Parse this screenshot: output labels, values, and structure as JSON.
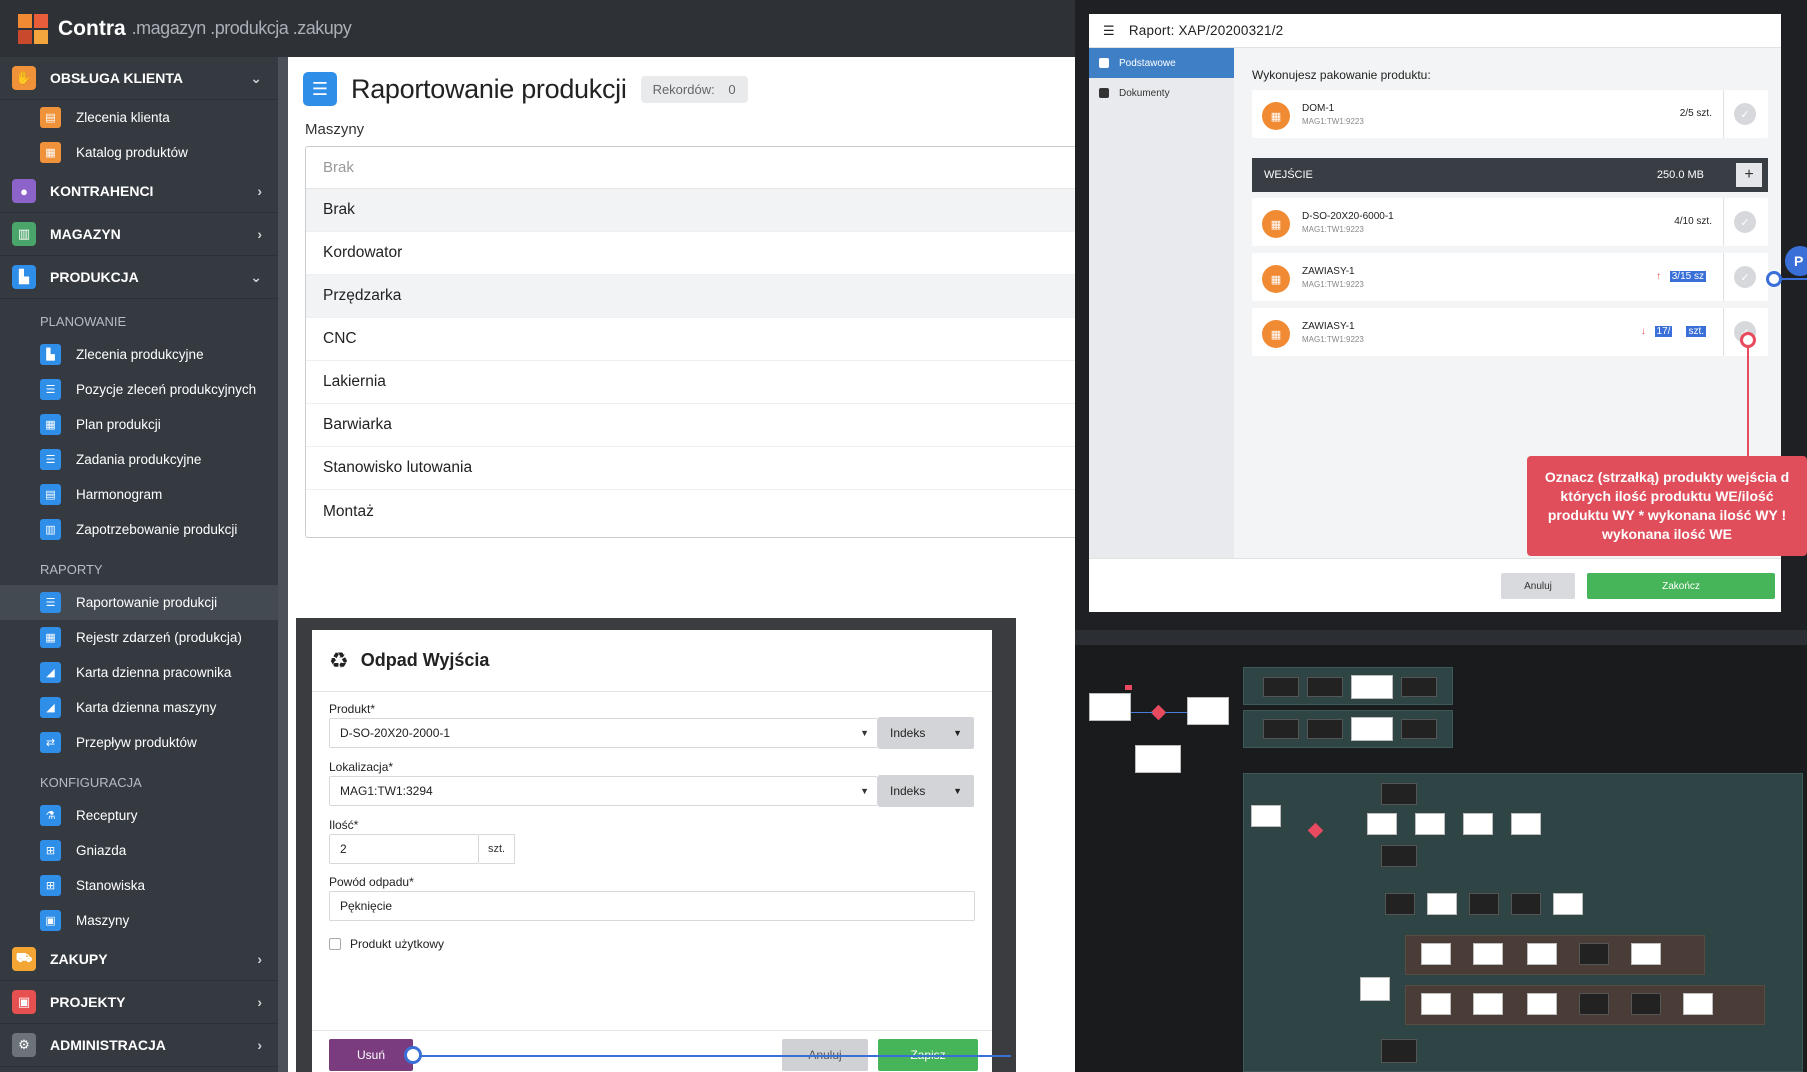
{
  "app": {
    "brand": "Contra",
    "subtitle": ".magazyn .produkcja .zakupy"
  },
  "sidebar": {
    "groups": [
      {
        "label": "OBSŁUGA KLIENTA",
        "chevron": "⌄",
        "icon": "handshake-icon",
        "color": "#f0923a"
      },
      {
        "label": "KONTRAHENCI",
        "chevron": "›",
        "icon": "users-icon",
        "color": "#8b63c9"
      },
      {
        "label": "MAGAZYN",
        "chevron": "›",
        "icon": "warehouse-icon",
        "color": "#4aa56a"
      },
      {
        "label": "PRODUKCJA",
        "chevron": "⌄",
        "icon": "factory-icon",
        "color": "#2f8fe8"
      },
      {
        "label": "ZAKUPY",
        "chevron": "›",
        "icon": "cart-icon",
        "color": "#f3a633"
      },
      {
        "label": "PROJEKTY",
        "chevron": "›",
        "icon": "briefcase-icon",
        "color": "#e65050"
      },
      {
        "label": "ADMINISTRACJA",
        "chevron": "›",
        "icon": "gear-icon",
        "color": "#6d737b"
      }
    ],
    "client_items": [
      "Zlecenia klienta",
      "Katalog produktów"
    ],
    "sections": {
      "planning": "PLANOWANIE",
      "reports": "RAPORTY",
      "config": "KONFIGURACJA"
    },
    "planning_items": [
      "Zlecenia produkcyjne",
      "Pozycje zleceń produkcyjnych",
      "Plan produkcji",
      "Zadania produkcyjne",
      "Harmonogram",
      "Zapotrzebowanie produkcji"
    ],
    "report_items": [
      "Raportowanie produkcji",
      "Rejestr zdarzeń (produkcja)",
      "Karta dzienna pracownika",
      "Karta dzienna maszyny",
      "Przepływ produktów"
    ],
    "config_items": [
      "Receptury",
      "Gniazda",
      "Stanowiska",
      "Maszyny"
    ]
  },
  "main": {
    "title": "Raportowanie produkcji",
    "records_label": "Rekordów:",
    "records_count": "0",
    "machines_label": "Maszyny",
    "placeholder": "Brak",
    "options": [
      "Brak",
      "Kordowator",
      "Przędzarka",
      "CNC",
      "Lakiernia",
      "Barwiarka",
      "Stanowisko lutowania",
      "Montaż"
    ]
  },
  "dialog": {
    "title": "Odpad Wyjścia",
    "product_label": "Produkt*",
    "product_value": "D-SO-20X20-2000-1",
    "location_label": "Lokalizacja*",
    "location_value": "MAG1:TW1:3294",
    "index_label": "Indeks",
    "qty_label": "Ilość*",
    "qty_value": "2",
    "qty_unit": "szt.",
    "reason_label": "Powód odpadu*",
    "reason_value": "Pęknięcie",
    "usable_label": "Produkt użytkowy",
    "delete_btn": "Usuń",
    "cancel_btn": "Anuluj",
    "save_btn": "Zapisz"
  },
  "report": {
    "title": "Raport: XAP/20200321/2",
    "tabs": [
      "Podstawowe",
      "Dokumenty"
    ],
    "pack_label": "Wykonujesz pakowanie produktu:",
    "output_product": {
      "name": "DOM-1",
      "loc": "MAG1:TW1:9223",
      "qty": "2/5 szt."
    },
    "input_bar": {
      "label": "WEJŚCIE",
      "size": "250.0 MB"
    },
    "inputs": [
      {
        "name": "D-SO-20X20-6000-1",
        "loc": "MAG1:TW1:9223",
        "qty": "4/10 szt.",
        "arrow": ""
      },
      {
        "name": "ZAWIASY-1",
        "loc": "MAG1:TW1:9223",
        "qty": "3/15 sz",
        "arrow": "↑"
      },
      {
        "name": "ZAWIASY-1",
        "loc": "MAG1:TW1:9223",
        "qty": "17/",
        "qty_tail": "szt.",
        "arrow": "↓"
      }
    ],
    "cancel_btn": "Anuluj",
    "finish_btn": "Zakończ",
    "note": "Oznacz (strzałką) produkty wejścia d których ilość produktu WE/ilość produktu WY * wykonana ilość WY ! wykonana ilość WE",
    "edge_marker": "P"
  },
  "colors": {
    "accent": "#2f8fe8",
    "orange": "#f08a33",
    "green": "#46b458",
    "purple": "#7a3c7f",
    "note_red": "#df4e5a"
  }
}
